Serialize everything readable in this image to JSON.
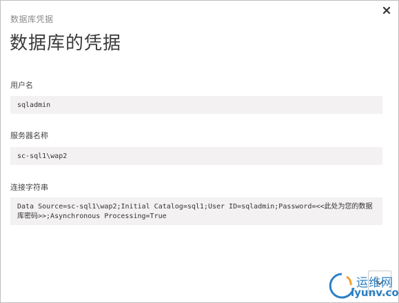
{
  "header": {
    "breadcrumb": "数据库凭据",
    "title": "数据库的凭据"
  },
  "fields": [
    {
      "label": "用户名",
      "value": "sqladmin"
    },
    {
      "label": "服务器名称",
      "value": "sc-sql1\\wap2"
    },
    {
      "label": "连接字符串",
      "value": "Data Source=sc-sql1\\wap2;Initial Catalog=sql1;User ID=sqladmin;Password=<<此处为您的数据库密码>>;Asynchronous Processing=True"
    }
  ],
  "watermark": {
    "top": "运维网",
    "bottom": "iyunv.com"
  },
  "icons": {
    "close": "close-icon",
    "expand": "expand-icon"
  },
  "colors": {
    "field_background": "#f3f1f2",
    "watermark": "#2b7fc3"
  }
}
